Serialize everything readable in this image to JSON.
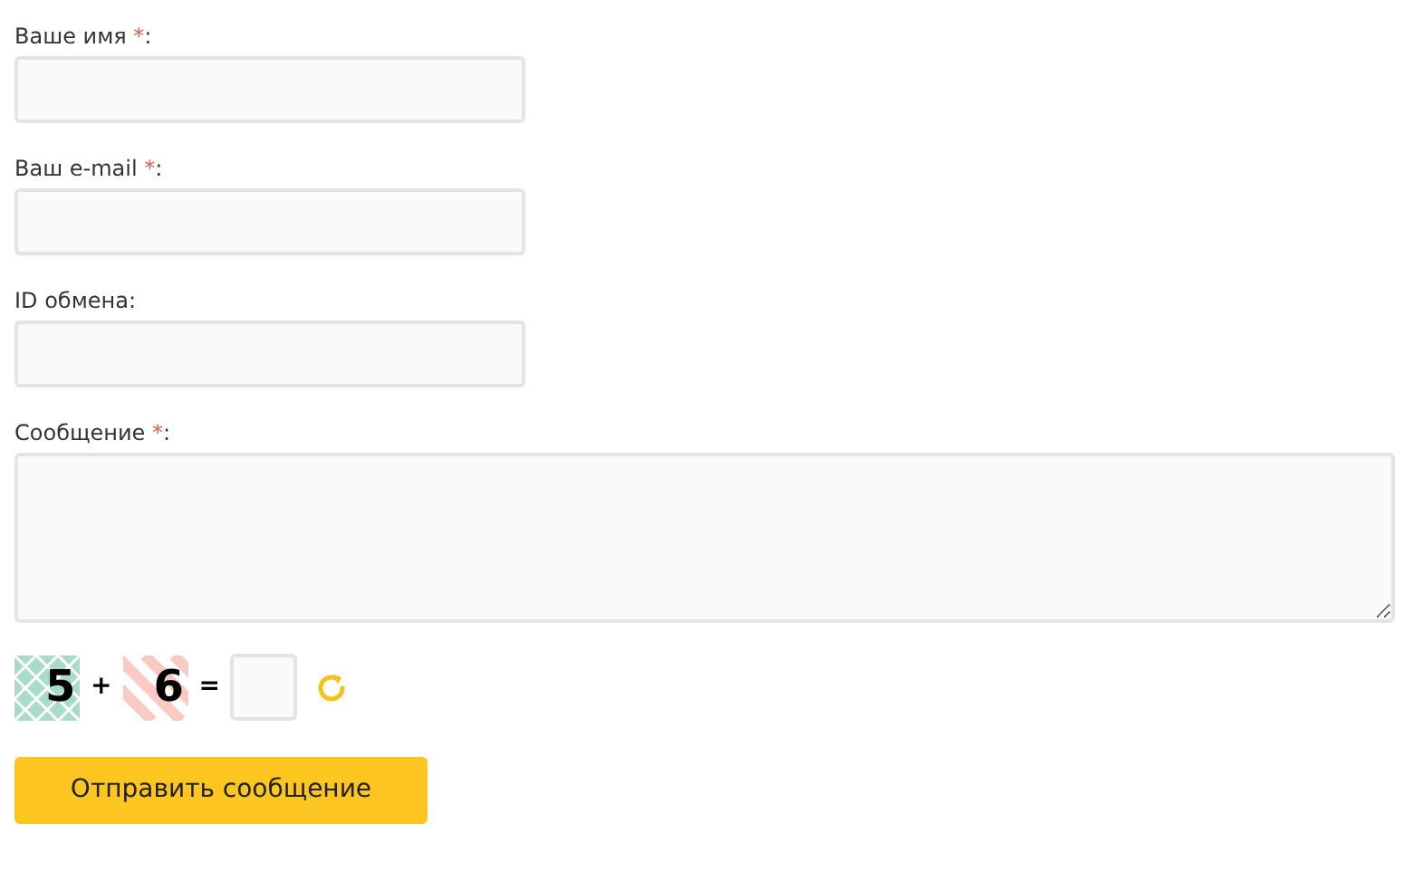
{
  "required_mark": "*",
  "label_suffix": ":",
  "fields": [
    {
      "kind": "input",
      "label": "Ваше имя",
      "required": true
    },
    {
      "kind": "input",
      "label": "Ваш e-mail",
      "required": true
    },
    {
      "kind": "input",
      "label": "ID обмена",
      "required": false
    },
    {
      "kind": "textarea",
      "label": "Сообщение",
      "required": true
    }
  ],
  "captcha": {
    "first": {
      "digit": "5",
      "kind": "grid",
      "color": "#a8dcc8"
    },
    "operator": "+",
    "second": {
      "digit": "6",
      "kind": "stripes",
      "color": "#f9c9c2"
    },
    "equals": "="
  },
  "submit_button": "Отправить сообщение"
}
